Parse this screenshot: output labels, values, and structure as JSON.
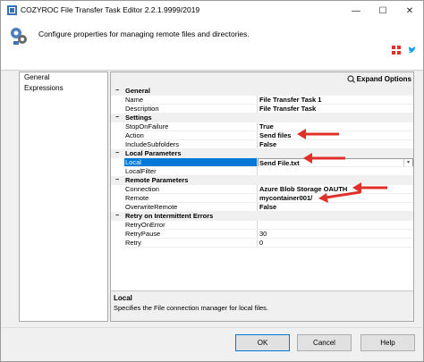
{
  "window": {
    "title": "COZYROC File Transfer Task Editor 2.2.1.9999/2019",
    "min_glyph": "—",
    "max_glyph": "☐",
    "close_glyph": "✕"
  },
  "header": {
    "description": "Configure properties for managing remote files and directories.",
    "icons": [
      "share-icon",
      "twitter-icon"
    ]
  },
  "left_list": {
    "items": [
      {
        "label": "General"
      },
      {
        "label": "Expressions"
      }
    ]
  },
  "toolbar": {
    "expand_label": "Expand Options"
  },
  "property_grid": {
    "rows": [
      {
        "type": "category",
        "label": "General",
        "toggle": "−"
      },
      {
        "type": "prop",
        "name": "Name",
        "value": "File Transfer Task 1",
        "bold": true
      },
      {
        "type": "prop",
        "name": "Description",
        "value": "File Transfer Task",
        "bold": true
      },
      {
        "type": "category",
        "label": "Settings",
        "toggle": "−"
      },
      {
        "type": "prop",
        "name": "StopOnFailure",
        "value": "True",
        "bold": true
      },
      {
        "type": "prop",
        "name": "Action",
        "value": "Send files",
        "bold": true
      },
      {
        "type": "prop",
        "name": "IncludeSubfolders",
        "value": "False",
        "bold": true
      },
      {
        "type": "category",
        "label": "Local Parameters",
        "toggle": "−"
      },
      {
        "type": "prop",
        "name": "Local",
        "value": "Send File.txt",
        "bold": true,
        "selected": true
      },
      {
        "type": "prop",
        "name": "LocalFilter",
        "value": "",
        "bold": false
      },
      {
        "type": "category",
        "label": "Remote Parameters",
        "toggle": "−"
      },
      {
        "type": "prop",
        "name": "Connection",
        "value": "Azure Blob Storage OAUTH",
        "bold": true
      },
      {
        "type": "prop",
        "name": "Remote",
        "value": "mycontainer001/",
        "bold": true
      },
      {
        "type": "prop",
        "name": "OverwriteRemote",
        "value": "False",
        "bold": true
      },
      {
        "type": "category",
        "label": "Retry on Intermittent Errors",
        "toggle": "−"
      },
      {
        "type": "prop",
        "name": "RetryOnError",
        "value": "",
        "bold": false
      },
      {
        "type": "prop",
        "name": "RetryPause",
        "value": "30",
        "bold": false
      },
      {
        "type": "prop",
        "name": "Retry",
        "value": "0",
        "bold": false
      }
    ]
  },
  "description_pane": {
    "title": "Local",
    "text": "Specifies the File connection manager for local files."
  },
  "buttons": {
    "ok": "OK",
    "cancel": "Cancel",
    "help": "Help"
  },
  "colors": {
    "selection": "#0078d7",
    "annotation_arrow": "#e0302a"
  }
}
